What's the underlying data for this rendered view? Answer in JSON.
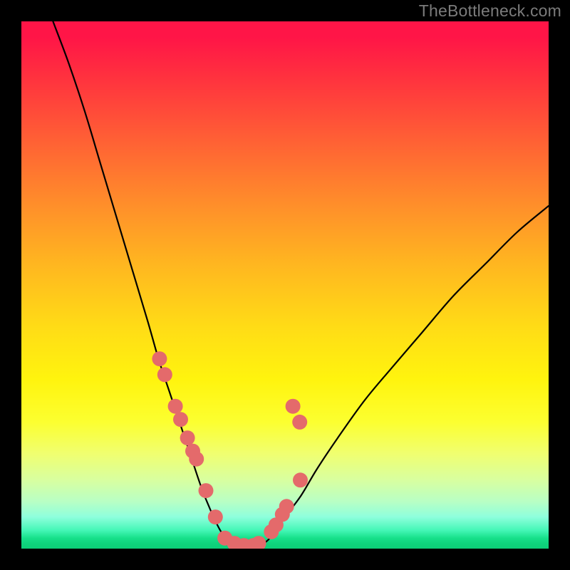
{
  "watermark": "TheBottleneck.com",
  "colors": {
    "frame": "#000000",
    "marker": "#e46a6b",
    "curve": "#000000",
    "gradient_top": "#ff1547",
    "gradient_bottom": "#0ccf77"
  },
  "chart_data": {
    "type": "line",
    "title": "",
    "xlabel": "",
    "ylabel": "",
    "xlim": [
      0,
      100
    ],
    "ylim": [
      0,
      100
    ],
    "grid": false,
    "legend": false,
    "notes": "V-shaped bottleneck curve over rainbow gradient; y is bottleneck % from bottom (0) to top (100). Curve minimum (~0) around x≈38–45.",
    "series": [
      {
        "name": "bottleneck-curve",
        "x": [
          6,
          9,
          12,
          15,
          18,
          21,
          24,
          26,
          28,
          30,
          32,
          34,
          36,
          38,
          40,
          42,
          44,
          46,
          48,
          50,
          53,
          56,
          60,
          65,
          70,
          76,
          82,
          88,
          94,
          100
        ],
        "y": [
          100,
          92,
          83,
          73,
          63,
          53,
          43,
          36,
          30,
          24,
          18,
          12,
          7,
          3,
          1,
          0.5,
          0.5,
          1,
          3,
          6,
          10,
          15,
          21,
          28,
          34,
          41,
          48,
          54,
          60,
          65
        ]
      }
    ],
    "markers": {
      "name": "highlighted-points",
      "note": "Salmon dots clustered near the trough of the curve",
      "x": [
        26.2,
        27.2,
        29.2,
        30.2,
        31.5,
        32.5,
        33.2,
        35.0,
        36.8,
        38.6,
        40.4,
        42.2,
        44.0,
        45.0,
        47.4,
        48.3,
        49.5,
        50.3,
        51.5,
        52.8,
        52.9
      ],
      "y": [
        36.0,
        33.0,
        27.0,
        24.5,
        21.0,
        18.5,
        17.0,
        11.0,
        6.0,
        2.0,
        1.0,
        0.6,
        0.6,
        1.0,
        3.2,
        4.5,
        6.5,
        8.0,
        27.0,
        24.0,
        13.0
      ]
    }
  }
}
